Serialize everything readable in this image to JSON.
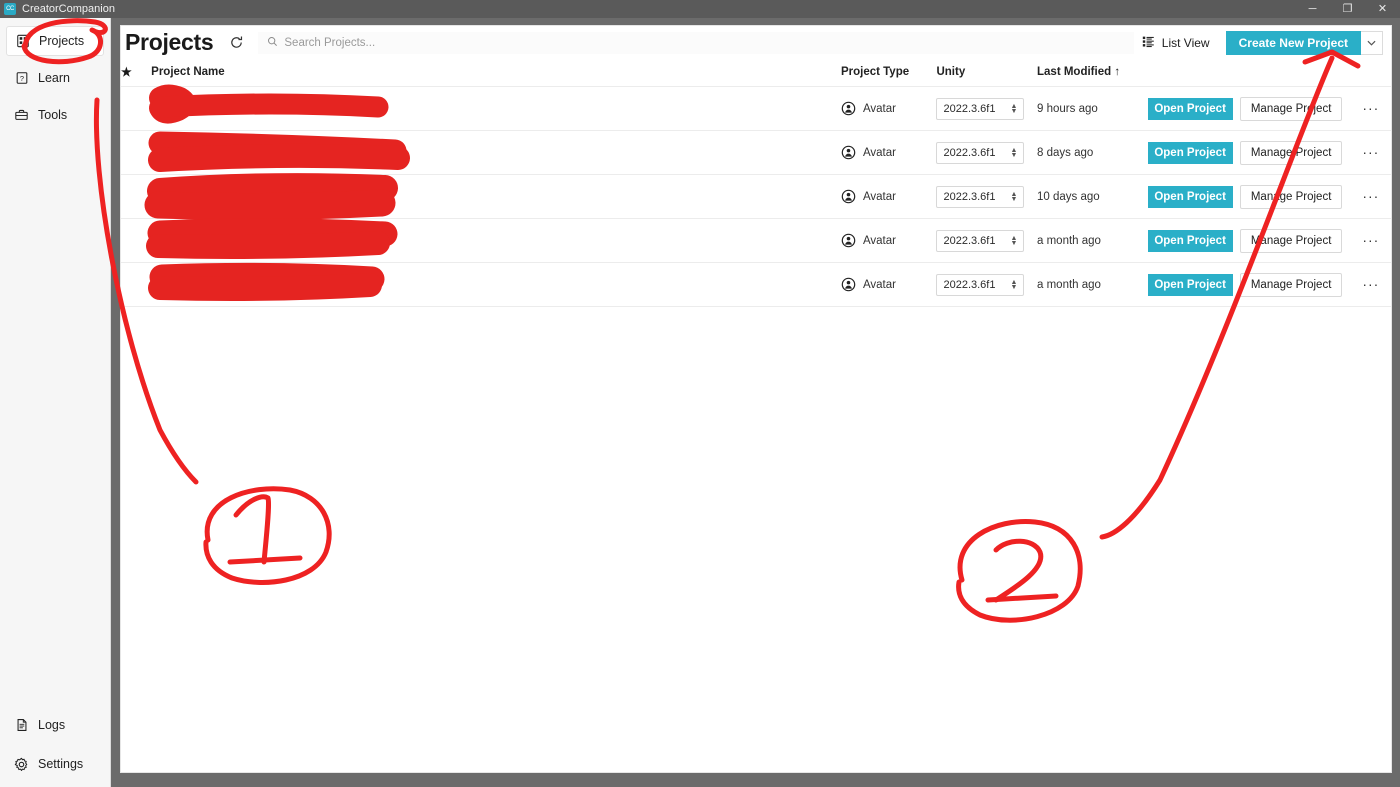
{
  "window": {
    "app_title": "CreatorCompanion",
    "app_icon": "creator-companion-icon",
    "minimize": "─",
    "maximize": "❐",
    "close": "✕"
  },
  "sidebar": {
    "top_items": [
      {
        "label": "Projects",
        "icon": "projects-grid-icon",
        "active": true
      },
      {
        "label": "Learn",
        "icon": "question-box-icon",
        "active": false
      },
      {
        "label": "Tools",
        "icon": "toolbox-icon",
        "active": false
      }
    ],
    "bottom_items": [
      {
        "label": "Logs",
        "icon": "document-icon"
      },
      {
        "label": "Settings",
        "icon": "gear-icon"
      }
    ]
  },
  "header": {
    "title": "Projects",
    "refresh_icon": "refresh-icon",
    "search": {
      "placeholder": "Search Projects...",
      "value": "",
      "icon": "search-icon"
    },
    "list_view_label": "List View",
    "list_view_icon": "list-view-icon",
    "create_label": "Create New Project",
    "create_caret_icon": "chevron-down-icon"
  },
  "table": {
    "columns": {
      "star": "★",
      "name": "Project Name",
      "type": "Project Type",
      "unity": "Unity",
      "modified": "Last Modified",
      "sort_arrow": "↑"
    },
    "rows": [
      {
        "name": "",
        "type": "Avatar",
        "type_icon": "avatar-icon",
        "unity": "2022.3.6f1",
        "modified": "9 hours ago",
        "open_label": "Open Project",
        "manage_label": "Manage Project",
        "more_label": "···"
      },
      {
        "name": "",
        "type": "Avatar",
        "type_icon": "avatar-icon",
        "unity": "2022.3.6f1",
        "modified": "8 days ago",
        "open_label": "Open Project",
        "manage_label": "Manage Project",
        "more_label": "···"
      },
      {
        "name": "",
        "type": "Avatar",
        "type_icon": "avatar-icon",
        "unity": "2022.3.6f1",
        "modified": "10 days ago",
        "open_label": "Open Project",
        "manage_label": "Manage Project",
        "more_label": "···"
      },
      {
        "name": "",
        "type": "Avatar",
        "type_icon": "avatar-icon",
        "unity": "2022.3.6f1",
        "modified": "a month ago",
        "open_label": "Open Project",
        "manage_label": "Manage Project",
        "more_label": "···"
      },
      {
        "name": "",
        "type": "Avatar",
        "type_icon": "avatar-icon",
        "unity": "2022.3.6f1",
        "modified": "a month ago",
        "open_label": "Open Project",
        "manage_label": "Manage Project",
        "more_label": "···"
      }
    ]
  },
  "annotations": {
    "color": "#ee2222",
    "marks": [
      {
        "id": "1",
        "label": "1",
        "target": "sidebar-item-projects",
        "description": "circled number one pointing to Projects sidebar item"
      },
      {
        "id": "2",
        "label": "2",
        "target": "create-new-project-button",
        "description": "circled number two pointing to Create New Project button"
      }
    ],
    "redactions": 5
  },
  "colors": {
    "accent_teal": "#2aafc8",
    "titlebar": "#5a5a5a",
    "sidebar_bg": "#f6f6f6",
    "annotation_red": "#ee2222"
  }
}
